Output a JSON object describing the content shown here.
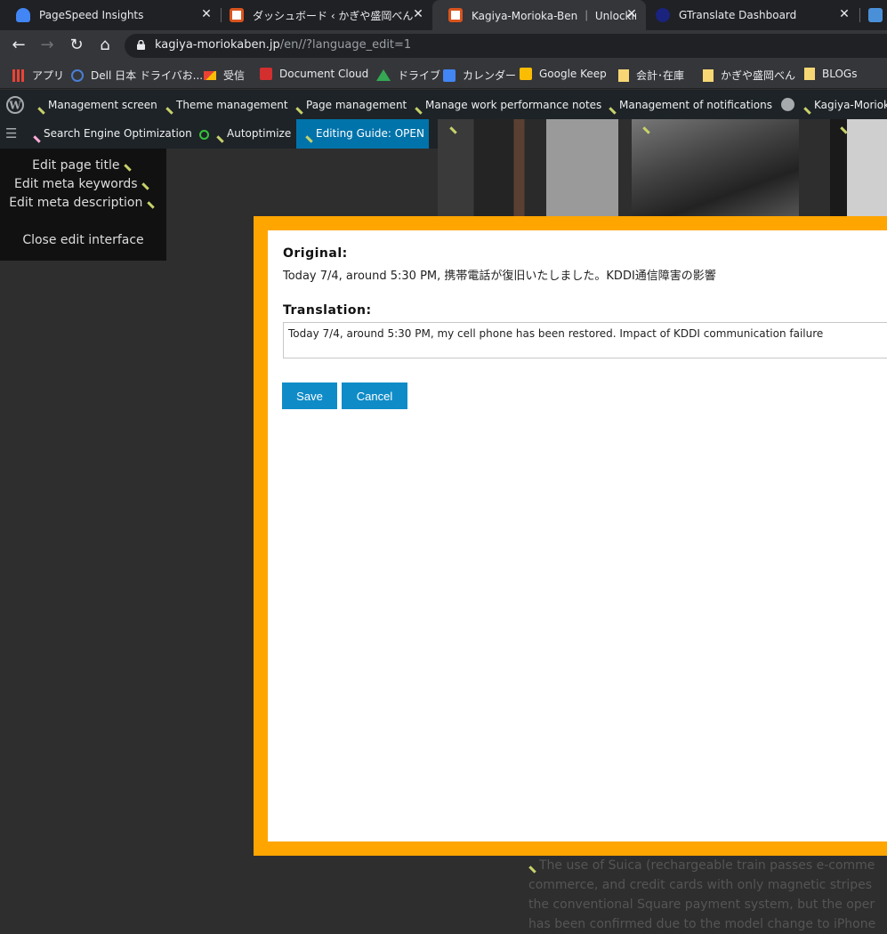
{
  "browser": {
    "tabs": [
      {
        "title": "PageSpeed Insights",
        "close": "✕"
      },
      {
        "title": "ダッシュボード ‹ かぎや盛岡べん｜鍵",
        "close": "✕"
      },
      {
        "title": "Kagiya-Morioka-Ben ｜ Unlocking",
        "close": "✕"
      },
      {
        "title": "GTranslate Dashboard",
        "close": "✕"
      }
    ],
    "url_host": "kagiya-moriokaben.jp",
    "url_rest": "/en//?language_edit=1",
    "bookmarks": [
      "アプリ",
      "Dell 日本 ドライバお...",
      "受信",
      "Document Cloud",
      "ドライブ",
      "カレンダー",
      "Google Keep",
      "会計･在庫",
      "かぎや盛岡べん",
      "BLOGs"
    ]
  },
  "adminbar": {
    "items": [
      "Management screen",
      "Theme management",
      "Page management",
      "Manage work performance notes",
      "Management of notifications",
      "Kagiya-Morioka"
    ]
  },
  "adminbar2": {
    "seo": "Search Engine Optimization",
    "autoptimize": "Autoptimize",
    "guide": "Editing Guide: OPEN"
  },
  "editpanel": {
    "title": "Edit page title",
    "keywords": "Edit meta keywords",
    "description": "Edit meta description",
    "close": "Close edit interface"
  },
  "modal": {
    "original_label": "Original:",
    "original_text": "Today 7/4, around 5:30 PM, 携帯電話が復旧いたしました。KDDI通信障害の影響",
    "translation_label": "Translation:",
    "translation_value": "Today 7/4, around 5:30 PM, my cell phone has been restored. Impact of KDDI communication failure",
    "save": "Save",
    "cancel": "Cancel"
  },
  "body_text": [
    "The use of Suica (rechargeable train passes e-comme",
    "commerce, and credit cards with only magnetic stripes",
    "the conventional Square payment system, but the oper",
    "has been confirmed due to the model change to iPhone"
  ],
  "colors": {
    "frame": "#ffa500",
    "button": "#0f8cc8",
    "adminbar": "#1d2327",
    "guide": "#0073aa"
  }
}
